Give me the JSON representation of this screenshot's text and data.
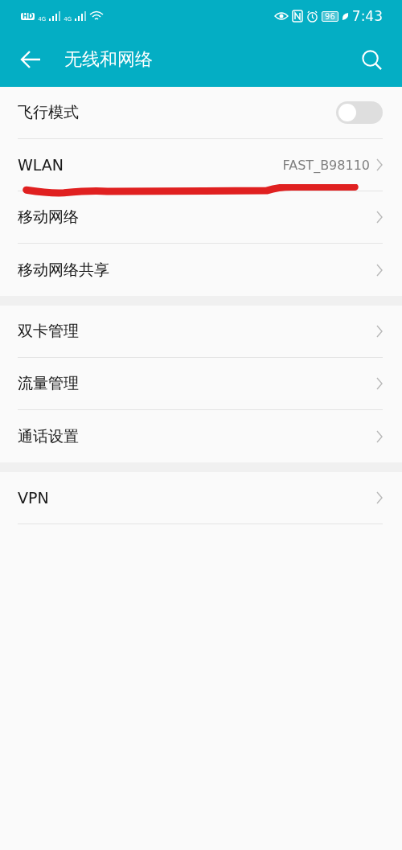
{
  "status_bar": {
    "hd": "HD",
    "networks": [
      "4G",
      "4G"
    ],
    "battery": "96",
    "time": "7:43"
  },
  "header": {
    "title": "无线和网络"
  },
  "groups": [
    {
      "items": [
        {
          "kind": "toggle",
          "label": "飞行模式",
          "on": false
        },
        {
          "kind": "link",
          "label": "WLAN",
          "value": "FAST_B98110"
        },
        {
          "kind": "link",
          "label": "移动网络"
        },
        {
          "kind": "link",
          "label": "移动网络共享"
        }
      ]
    },
    {
      "items": [
        {
          "kind": "link",
          "label": "双卡管理"
        },
        {
          "kind": "link",
          "label": "流量管理"
        },
        {
          "kind": "link",
          "label": "通话设置"
        }
      ]
    },
    {
      "items": [
        {
          "kind": "link",
          "label": "VPN"
        }
      ]
    }
  ]
}
